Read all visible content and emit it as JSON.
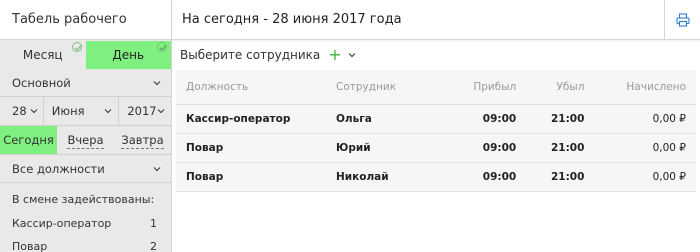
{
  "app_title": "Табель рабочего времени",
  "page_title": "На сегодня - 28 июня 2017 года",
  "view_modes": [
    {
      "label": "Месяц"
    },
    {
      "label": "День"
    }
  ],
  "schedule_select": "Основной",
  "date": {
    "day": "28",
    "month": "Июня",
    "year": "2017"
  },
  "quick_days": [
    {
      "label": "Сегодня"
    },
    {
      "label": "Вчера"
    },
    {
      "label": "Завтра"
    }
  ],
  "position_filter": "Все должности",
  "summary": {
    "title": "В смене задействованы:",
    "items": [
      {
        "label": "Кассир-оператор",
        "count": "1"
      },
      {
        "label": "Повар",
        "count": "2"
      }
    ]
  },
  "employee_picker": {
    "label": "Выберите сотрудника",
    "add_symbol": "+"
  },
  "table": {
    "headers": {
      "position": "Должность",
      "employee": "Сотрудник",
      "arrived": "Прибыл",
      "left": "Убыл",
      "accrued": "Начислено"
    },
    "rows": [
      {
        "position": "Кассир-оператор",
        "employee": "Ольга",
        "arrived": "09:00",
        "left": "21:00",
        "accrued": "0,00 ₽"
      },
      {
        "position": "Повар",
        "employee": "Юрий",
        "arrived": "09:00",
        "left": "21:00",
        "accrued": "0,00 ₽"
      },
      {
        "position": "Повар",
        "employee": "Николай",
        "arrived": "09:00",
        "left": "21:00",
        "accrued": "0,00 ₽"
      }
    ]
  },
  "colors": {
    "accent_green": "#7fef7f",
    "plus_green": "#3cb83c",
    "print_icon": "#2a7fd4"
  }
}
